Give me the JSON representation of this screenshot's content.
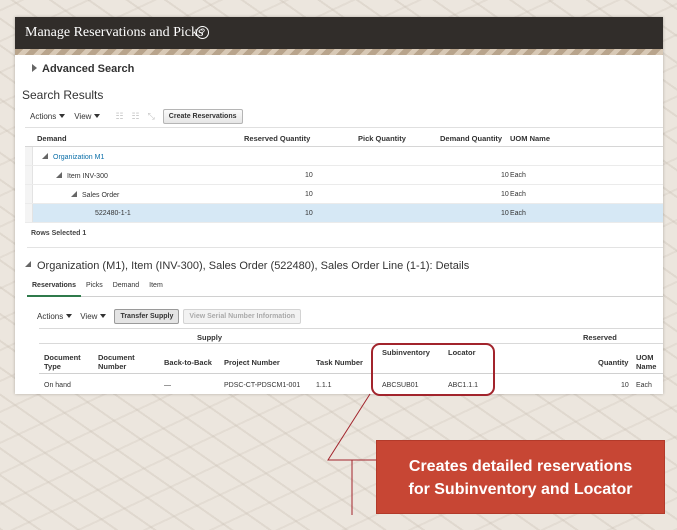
{
  "window": {
    "title": "Manage Reservations and Picks",
    "help_icon": "?"
  },
  "advanced_search": {
    "label": "Advanced Search"
  },
  "search_results": {
    "title": "Search Results",
    "toolbar": {
      "actions_label": "Actions",
      "view_label": "View",
      "icons": [
        "expand-icon",
        "collapse-icon",
        "detach-icon"
      ],
      "create_button": "Create Reservations"
    },
    "columns": [
      "Demand",
      "Reserved Quantity",
      "Pick Quantity",
      "Demand Quantity",
      "UOM Name"
    ],
    "rows": [
      {
        "demand": "Organization M1",
        "reserved": "",
        "pick": "",
        "demand_qty": "",
        "uom": ""
      },
      {
        "demand": "Item INV-300",
        "reserved": "10",
        "pick": "",
        "demand_qty": "10",
        "uom": "Each"
      },
      {
        "demand": "Sales Order",
        "reserved": "10",
        "pick": "",
        "demand_qty": "10",
        "uom": "Each"
      },
      {
        "demand": "522480-1-1",
        "reserved": "10",
        "pick": "",
        "demand_qty": "10",
        "uom": "Each"
      }
    ],
    "rows_selected_label": "Rows Selected",
    "rows_selected_count": "1"
  },
  "details": {
    "title": "Organization (M1), Item (INV-300), Sales Order (522480), Sales Order Line (1-1): Details",
    "tabs": [
      "Reservations",
      "Picks",
      "Demand",
      "Item"
    ],
    "active_tab": "Reservations",
    "toolbar": {
      "actions_label": "Actions",
      "view_label": "View",
      "transfer_button": "Transfer Supply",
      "serial_button": "View Serial Number Information"
    },
    "groups": {
      "supply": "Supply",
      "reserved": "Reserved"
    },
    "columns": {
      "doc_type": "Document Type",
      "doc_number": "Document Number",
      "back_to_back": "Back-to-Back",
      "project_number": "Project Number",
      "task_number": "Task Number",
      "subinventory": "Subinventory",
      "locator": "Locator",
      "quantity": "Quantity",
      "uom_name": "UOM Name"
    },
    "row": {
      "doc_type": "On hand",
      "doc_number": "",
      "back_to_back": "—",
      "project_number": "PDSC-CT-PDSCM1-001",
      "task_number": "1.1.1",
      "subinventory": "ABCSUB01",
      "locator": "ABC1.1.1",
      "quantity": "10",
      "uom_name": "Each"
    }
  },
  "callout": {
    "line1": "Creates detailed reservations",
    "line2": "for Subinventory and Locator",
    "accent": "#c74634"
  }
}
